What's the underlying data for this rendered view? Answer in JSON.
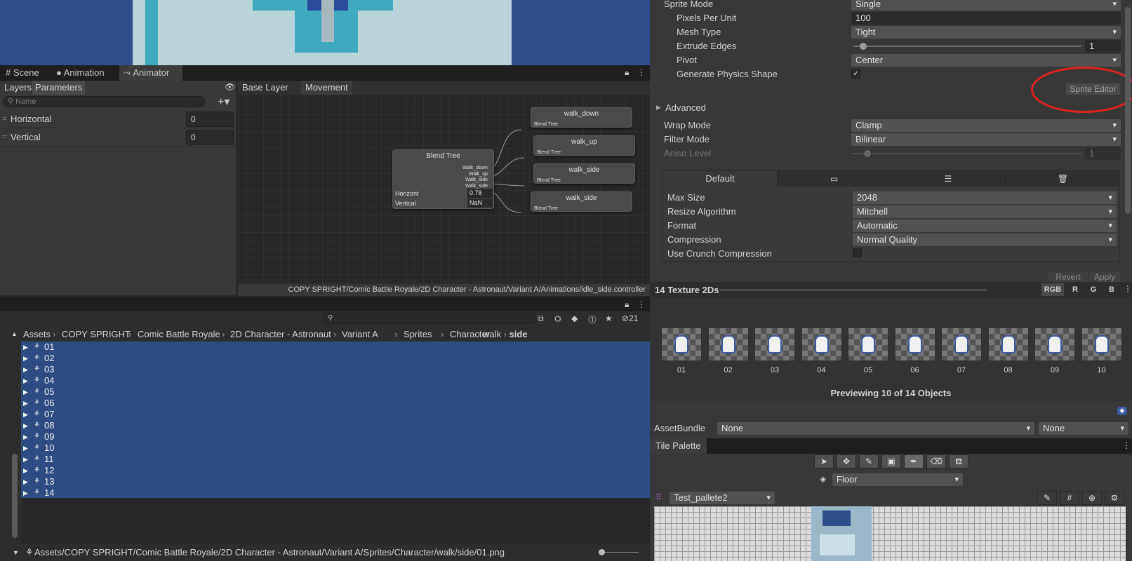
{
  "scene_tabs": [
    {
      "label": "Scene",
      "icon": "grid-icon"
    },
    {
      "label": "Animation",
      "icon": "clock-icon"
    },
    {
      "label": "Animator",
      "icon": "animator-icon"
    }
  ],
  "params": {
    "tabs": [
      "Layers",
      "Parameters"
    ],
    "search_placeholder": "Name",
    "items": [
      {
        "name": "Horizontal",
        "value": "0"
      },
      {
        "name": "Vertical",
        "value": "0"
      }
    ]
  },
  "graph": {
    "breadcrumbs": [
      "Base Layer",
      "Movement"
    ],
    "blend_node": {
      "title": "Blend Tree",
      "outputs": [
        "Walk_down",
        "Walk_up",
        "Walk_side",
        "Walk_side"
      ],
      "param1": "Horizont",
      "value1": "0.78",
      "param2": "Vertical",
      "value2": "NaN"
    },
    "motions": [
      {
        "title": "walk_down",
        "sub": "Blend Tree"
      },
      {
        "title": "walk_up",
        "sub": "Blend Tree"
      },
      {
        "title": "walk_side",
        "sub": "Blend Tree"
      },
      {
        "title": "walk_side",
        "sub": "Blend Tree"
      }
    ],
    "path": "COPY SPRIGHT/Comic Battle Royale/2D Character - Astronaut/Variant A/Animations/idle_side.controller"
  },
  "project": {
    "filter_count": "21",
    "breadcrumbs": [
      "Assets",
      "COPY SPRIGHT",
      "Comic Battle Royale",
      "2D Character - Astronaut",
      "Variant A",
      "Sprites",
      "Character",
      "walk",
      "side"
    ],
    "items": [
      "01",
      "02",
      "03",
      "04",
      "05",
      "06",
      "07",
      "08",
      "09",
      "10",
      "11",
      "12",
      "13",
      "14"
    ],
    "selected_path": "Assets/COPY SPRIGHT/Comic Battle Royale/2D Character - Astronaut/Variant A/Sprites/Character/walk/side/01.png"
  },
  "inspector": {
    "sprite_mode": {
      "label": "Sprite Mode",
      "value": "Single"
    },
    "pixels_per_unit": {
      "label": "Pixels Per Unit",
      "value": "100"
    },
    "mesh_type": {
      "label": "Mesh Type",
      "value": "Tight"
    },
    "extrude_edges": {
      "label": "Extrude Edges",
      "value": "1",
      "fraction": 0.03
    },
    "pivot": {
      "label": "Pivot",
      "value": "Center"
    },
    "generate_physics": {
      "label": "Generate Physics Shape",
      "checked": true
    },
    "sprite_editor": "Sprite Editor",
    "advanced": "Advanced",
    "wrap_mode": {
      "label": "Wrap Mode",
      "value": "Clamp"
    },
    "filter_mode": {
      "label": "Filter Mode",
      "value": "Bilinear"
    },
    "aniso": {
      "label": "Aniso Level",
      "value": "1",
      "fraction": 0.05
    },
    "platform_tabs": [
      "Default",
      "monitor-icon",
      "list-icon",
      "trash-icon"
    ],
    "max_size": {
      "label": "Max Size",
      "value": "2048"
    },
    "resize": {
      "label": "Resize Algorithm",
      "value": "Mitchell"
    },
    "format": {
      "label": "Format",
      "value": "Automatic"
    },
    "compression": {
      "label": "Compression",
      "value": "Normal Quality"
    },
    "crunch": {
      "label": "Use Crunch Compression",
      "checked": false
    },
    "revert": "Revert",
    "apply": "Apply"
  },
  "preview": {
    "title": "14 Texture 2Ds",
    "channels": [
      "RGB",
      "R",
      "G",
      "B"
    ],
    "thumbs": [
      "01",
      "02",
      "03",
      "04",
      "05",
      "06",
      "07",
      "08",
      "09",
      "10"
    ],
    "caption": "Previewing 10 of 14 Objects"
  },
  "assetbundle": {
    "label": "AssetBundle",
    "name": "None",
    "variant": "None"
  },
  "tile_palette": {
    "title": "Tile Palette",
    "layer": "Floor",
    "palette": "Test_pallete2"
  },
  "colors": {
    "selection": "#2d4d82",
    "annotation": "#e02020",
    "accent": "#3c5aa0"
  }
}
